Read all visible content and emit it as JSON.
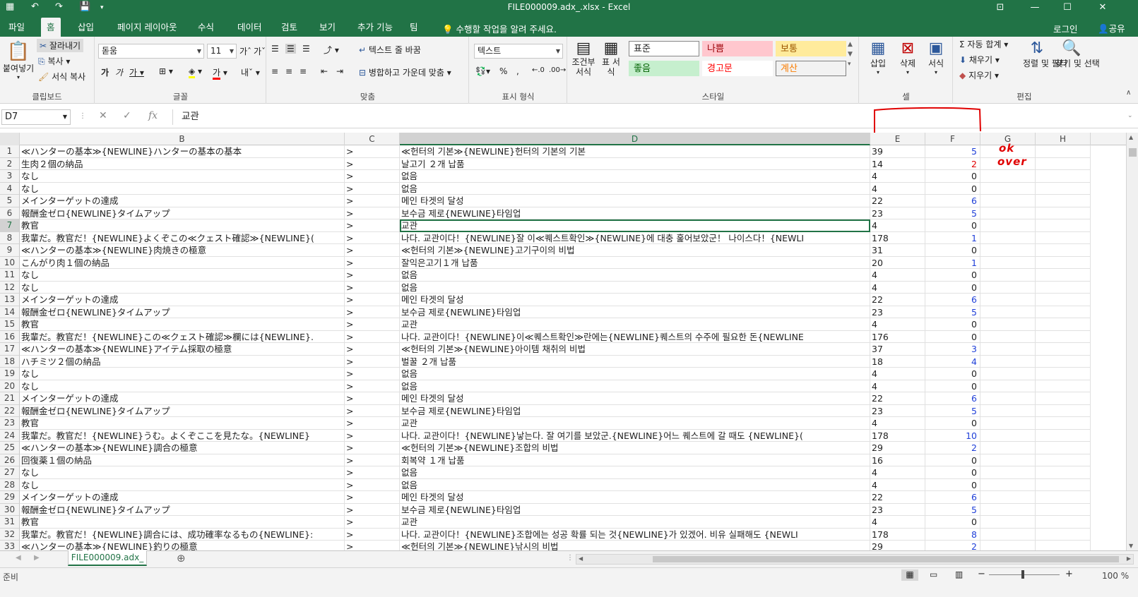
{
  "window": {
    "title": "FILE000009.adx_.xlsx - Excel"
  },
  "tabs": [
    "파일",
    "홈",
    "삽입",
    "페이지 레이아웃",
    "수식",
    "데이터",
    "검토",
    "보기",
    "추가 기능",
    "팀"
  ],
  "active_tab": "홈",
  "tell_me": "수행할 작업을 알려 주세요.",
  "account": {
    "login": "로그인",
    "share": "공유"
  },
  "ribbon": {
    "clipboard": {
      "label": "클립보드",
      "paste": "붙여넣기",
      "cut": "잘라내기",
      "copy": "복사",
      "format_painter": "서식 복사"
    },
    "font": {
      "label": "글꼴",
      "font_name": "돋움",
      "font_size": "11"
    },
    "alignment": {
      "label": "맞춤",
      "wrap_text": "텍스트 줄 바꿈",
      "merge_center": "병합하고 가운데 맞춤"
    },
    "number": {
      "label": "표시 형식",
      "format": "텍스트"
    },
    "styles": {
      "label": "스타일",
      "conditional": "조건부 서식",
      "table": "표 서식",
      "cells": [
        {
          "text": "표준",
          "bg": "#ffffff",
          "color": "#222222",
          "border": "#888888"
        },
        {
          "text": "나쁨",
          "bg": "#ffc7ce",
          "color": "#9c0006",
          "border": "#ffc7ce"
        },
        {
          "text": "보통",
          "bg": "#ffeb9c",
          "color": "#9c5700",
          "border": "#ffeb9c"
        },
        {
          "text": "좋음",
          "bg": "#c6efce",
          "color": "#006100",
          "border": "#c6efce"
        },
        {
          "text": "경고문",
          "bg": "#ffffff",
          "color": "#ff0000",
          "border": "#ffffff"
        },
        {
          "text": "계산",
          "bg": "#f2f2f2",
          "color": "#fa7d00",
          "border": "#7f7f7f"
        }
      ]
    },
    "cells_group": {
      "label": "셀",
      "insert": "삽입",
      "delete": "삭제",
      "format": "서식"
    },
    "editing": {
      "label": "편집",
      "autosum": "자동 합계",
      "fill": "채우기",
      "clear": "지우기",
      "sort_filter": "정렬 및 필터",
      "find_select": "찾기 및 선택"
    }
  },
  "formula_bar": {
    "name_box": "D7",
    "fx": "fx",
    "value": "교관"
  },
  "columns": [
    "B",
    "C",
    "D",
    "E",
    "F",
    "G",
    "H"
  ],
  "selected_column": "D",
  "selected_row": 7,
  "rows": [
    {
      "n": "1",
      "b": "≪ハンターの基本≫{NEWLINE}ハンターの基本の基本",
      "c": ">",
      "d": "≪헌터의 기본≫{NEWLINE}헌터의 기본의 기본",
      "e": "39",
      "f": "5",
      "fc": "blue"
    },
    {
      "n": "2",
      "b": "生肉２個の納品",
      "c": ">",
      "d": "날고기 ２개 납품",
      "e": "14",
      "f": "2",
      "fc": "red"
    },
    {
      "n": "3",
      "b": "なし",
      "c": ">",
      "d": "없음",
      "e": "4",
      "f": "0",
      "fc": "black"
    },
    {
      "n": "4",
      "b": "なし",
      "c": ">",
      "d": "없음",
      "e": "4",
      "f": "0",
      "fc": "black"
    },
    {
      "n": "5",
      "b": "メインターゲットの達成",
      "c": ">",
      "d": "메인 타겟의 달성",
      "e": "22",
      "f": "6",
      "fc": "blue"
    },
    {
      "n": "6",
      "b": "報酬金ゼロ{NEWLINE}タイムアップ",
      "c": ">",
      "d": "보수금 제로{NEWLINE}타임업",
      "e": "23",
      "f": "5",
      "fc": "blue"
    },
    {
      "n": "7",
      "b": "教官",
      "c": ">",
      "d": "교관",
      "e": "4",
      "f": "0",
      "fc": "black"
    },
    {
      "n": "8",
      "b": "我輩だ。教官だ！{NEWLINE}よくぞこの≪クェスト確認≫{NEWLINE}(",
      "c": ">",
      "d": "나다. 교관이다！{NEWLINE}잘 이≪퀘스트확인≫{NEWLINE}에 대충 훑어보았군！ 나이스다！{NEWLI",
      "e": "178",
      "f": "1",
      "fc": "blue"
    },
    {
      "n": "9",
      "b": "≪ハンターの基本≫{NEWLINE}肉焼きの極意",
      "c": ">",
      "d": "≪헌터의 기본≫{NEWLINE}고기구이의 비법",
      "e": "31",
      "f": "0",
      "fc": "black"
    },
    {
      "n": "10",
      "b": "こんがり肉１個の納品",
      "c": ">",
      "d": "잘익은고기１개 납품",
      "e": "20",
      "f": "1",
      "fc": "blue"
    },
    {
      "n": "11",
      "b": "なし",
      "c": ">",
      "d": "없음",
      "e": "4",
      "f": "0",
      "fc": "black"
    },
    {
      "n": "12",
      "b": "なし",
      "c": ">",
      "d": "없음",
      "e": "4",
      "f": "0",
      "fc": "black"
    },
    {
      "n": "13",
      "b": "メインターゲットの達成",
      "c": ">",
      "d": "메인 타겟의 달성",
      "e": "22",
      "f": "6",
      "fc": "blue"
    },
    {
      "n": "14",
      "b": "報酬金ゼロ{NEWLINE}タイムアップ",
      "c": ">",
      "d": "보수금 제로{NEWLINE}타임업",
      "e": "23",
      "f": "5",
      "fc": "blue"
    },
    {
      "n": "15",
      "b": "教官",
      "c": ">",
      "d": "교관",
      "e": "4",
      "f": "0",
      "fc": "black"
    },
    {
      "n": "16",
      "b": "我輩だ。教官だ！{NEWLINE}この≪クェスト確認≫欄には{NEWLINE}.",
      "c": ">",
      "d": "나다. 교관이다！{NEWLINE}이≪퀘스트확인≫란에는{NEWLINE}퀘스트의 수주에 필요한 돈{NEWLINE",
      "e": "176",
      "f": "0",
      "fc": "black"
    },
    {
      "n": "17",
      "b": "≪ハンターの基本≫{NEWLINE}アイテム採取の極意",
      "c": ">",
      "d": "≪헌터의 기본≫{NEWLINE}아이템 채취의 비법",
      "e": "37",
      "f": "3",
      "fc": "blue"
    },
    {
      "n": "18",
      "b": "ハチミツ２個の納品",
      "c": ">",
      "d": "벌꿀 ２개 납품",
      "e": "18",
      "f": "4",
      "fc": "blue"
    },
    {
      "n": "19",
      "b": "なし",
      "c": ">",
      "d": "없음",
      "e": "4",
      "f": "0",
      "fc": "black"
    },
    {
      "n": "20",
      "b": "なし",
      "c": ">",
      "d": "없음",
      "e": "4",
      "f": "0",
      "fc": "black"
    },
    {
      "n": "21",
      "b": "メインターゲットの達成",
      "c": ">",
      "d": "메인 타겟의 달성",
      "e": "22",
      "f": "6",
      "fc": "blue"
    },
    {
      "n": "22",
      "b": "報酬金ゼロ{NEWLINE}タイムアップ",
      "c": ">",
      "d": "보수금 제로{NEWLINE}타임업",
      "e": "23",
      "f": "5",
      "fc": "blue"
    },
    {
      "n": "23",
      "b": "教官",
      "c": ">",
      "d": "교관",
      "e": "4",
      "f": "0",
      "fc": "black"
    },
    {
      "n": "24",
      "b": "我輩だ。教官だ！{NEWLINE}うむ。よくぞここを見たな。{NEWLINE}",
      "c": ">",
      "d": "나다. 교관이다！{NEWLINE}낳는다. 잘 여기를 보았군.{NEWLINE}어느 퀘스트에 갈 때도 {NEWLINE}(",
      "e": "178",
      "f": "10",
      "fc": "blue"
    },
    {
      "n": "25",
      "b": "≪ハンターの基本≫{NEWLINE}調合の極意",
      "c": ">",
      "d": "≪헌터의 기본≫{NEWLINE}조합의 비법",
      "e": "29",
      "f": "2",
      "fc": "blue"
    },
    {
      "n": "26",
      "b": "回復薬１個の納品",
      "c": ">",
      "d": "회복약 １개 납품",
      "e": "16",
      "f": "0",
      "fc": "black"
    },
    {
      "n": "27",
      "b": "なし",
      "c": ">",
      "d": "없음",
      "e": "4",
      "f": "0",
      "fc": "black"
    },
    {
      "n": "28",
      "b": "なし",
      "c": ">",
      "d": "없음",
      "e": "4",
      "f": "0",
      "fc": "black"
    },
    {
      "n": "29",
      "b": "メインターゲットの達成",
      "c": ">",
      "d": "메인 타겟의 달성",
      "e": "22",
      "f": "6",
      "fc": "blue"
    },
    {
      "n": "30",
      "b": "報酬金ゼロ{NEWLINE}タイムアップ",
      "c": ">",
      "d": "보수금 제로{NEWLINE}타임업",
      "e": "23",
      "f": "5",
      "fc": "blue"
    },
    {
      "n": "31",
      "b": "教官",
      "c": ">",
      "d": "교관",
      "e": "4",
      "f": "0",
      "fc": "black"
    },
    {
      "n": "32",
      "b": "我輩だ。教官だ！{NEWLINE}調合には、成功確率なるもの{NEWLINE}:",
      "c": ">",
      "d": "나다. 교관이다！{NEWLINE}조합에는 성공 확률 되는 것{NEWLINE}가 있겠어. 비유 실패해도 {NEWLI",
      "e": "178",
      "f": "8",
      "fc": "blue"
    },
    {
      "n": "33",
      "b": "≪ハンターの基本≫{NEWLINE}釣りの極意",
      "c": ">",
      "d": "≪헌터의 기본≫{NEWLINE}낚시의 비법",
      "e": "29",
      "f": "2",
      "fc": "blue"
    }
  ],
  "annotations": {
    "ok": "ok",
    "over": "over"
  },
  "sheet_tab": "FILE000009.adx_",
  "status": {
    "ready": "준비",
    "zoom": "100 %"
  }
}
